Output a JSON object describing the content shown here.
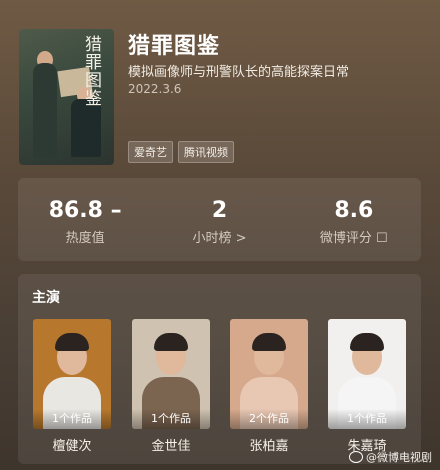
{
  "show": {
    "title": "猎罪图鉴",
    "subtitle": "模拟画像师与刑警队长的高能探案日常",
    "date": "2022.3.6",
    "poster_title": "猎罪图鉴",
    "tags": [
      "爱奇艺",
      "腾讯视频"
    ]
  },
  "stats": [
    {
      "value": "86.8 –",
      "label": "热度值"
    },
    {
      "value": "2",
      "label": "小时榜 >"
    },
    {
      "value": "8.6",
      "label": "微博评分 ☐"
    }
  ],
  "cast": {
    "heading": "主演",
    "actors": [
      {
        "name": "檀健次",
        "works": "1个作品",
        "bg": "#b7782e",
        "cloth": "#e9e7e2"
      },
      {
        "name": "金世佳",
        "works": "1个作品",
        "bg": "#cfc2b0",
        "cloth": "#7b6450"
      },
      {
        "name": "张柏嘉",
        "works": "2个作品",
        "bg": "#d6a98c",
        "cloth": "#e8c7b3"
      },
      {
        "name": "朱嘉琦",
        "works": "1个作品",
        "bg": "#f1f0ee",
        "cloth": "#f5f5f5"
      }
    ]
  },
  "watermark": "@微博电视剧"
}
